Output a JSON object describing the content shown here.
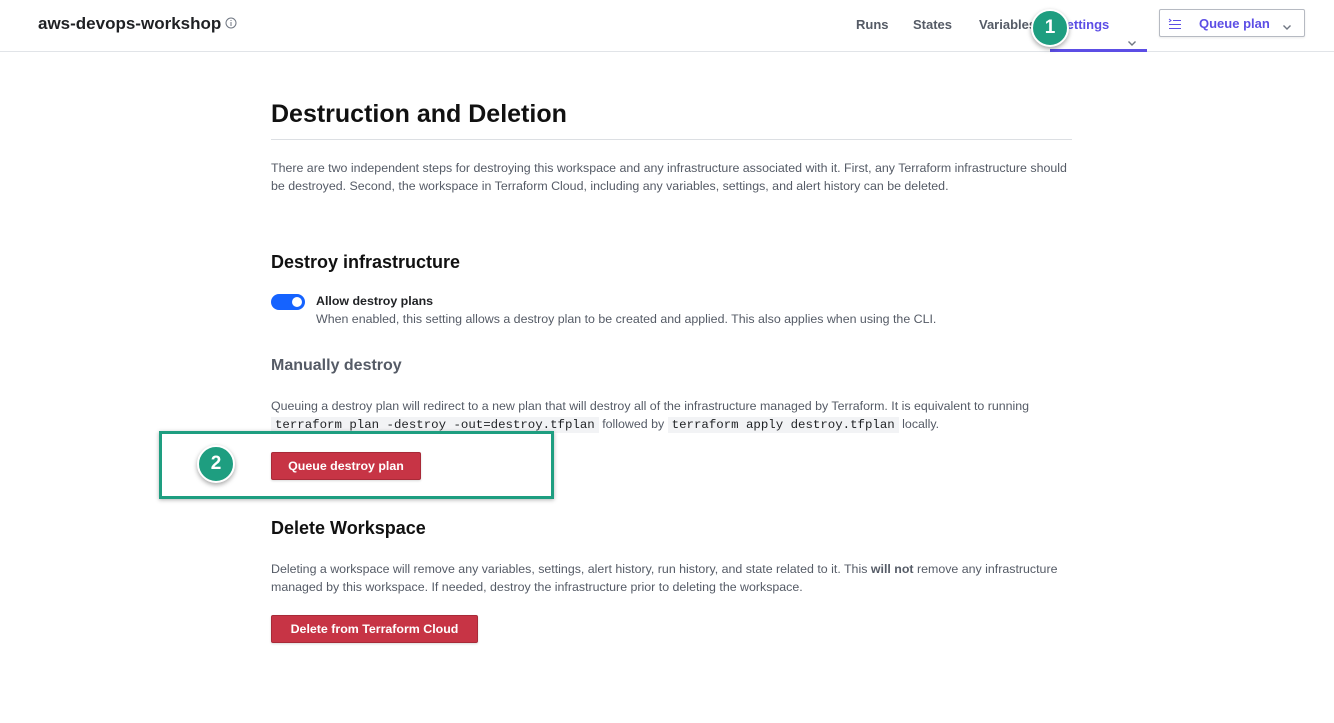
{
  "header": {
    "workspace_name": "aws-devops-workshop",
    "info_icon": "info-icon",
    "nav": {
      "runs": "Runs",
      "states": "States",
      "variables": "Variables",
      "settings": "Settings"
    },
    "queue_plan_label": "Queue plan",
    "active_color": "#5c4ee5"
  },
  "annotations": {
    "callout_1": "1",
    "callout_2": "2",
    "color": "#1e9e80"
  },
  "page": {
    "title": "Destruction and Deletion",
    "intro": "There are two independent steps for destroying this workspace and any infrastructure associated with it. First, any Terraform infrastructure should be destroyed. Second, the workspace in Terraform Cloud, including any variables, settings, and alert history can be deleted."
  },
  "destroy_section": {
    "heading": "Destroy infrastructure",
    "toggle_label": "Allow destroy plans",
    "toggle_on": true,
    "toggle_description": "When enabled, this setting allows a destroy plan to be created and applied. This also applies when using the CLI.",
    "manual_heading": "Manually destroy",
    "manual_text_1": "Queuing a destroy plan will redirect to a new plan that will destroy all of the infrastructure managed by Terraform. It is equivalent to running",
    "code_1": "terraform plan -destroy -out=destroy.tfplan",
    "manual_text_2": "followed by",
    "code_2": "terraform apply destroy.tfplan",
    "manual_text_3": "locally.",
    "button_label": "Queue destroy plan",
    "danger_color": "#c73445"
  },
  "delete_section": {
    "heading": "Delete Workspace",
    "text_1": "Deleting a workspace will remove any variables, settings, alert history, run history, and state related to it. This",
    "text_bold": "will not",
    "text_2": "remove any infrastructure managed by this workspace. If needed, destroy the infrastructure prior to deleting the workspace.",
    "button_label": "Delete from Terraform Cloud"
  }
}
